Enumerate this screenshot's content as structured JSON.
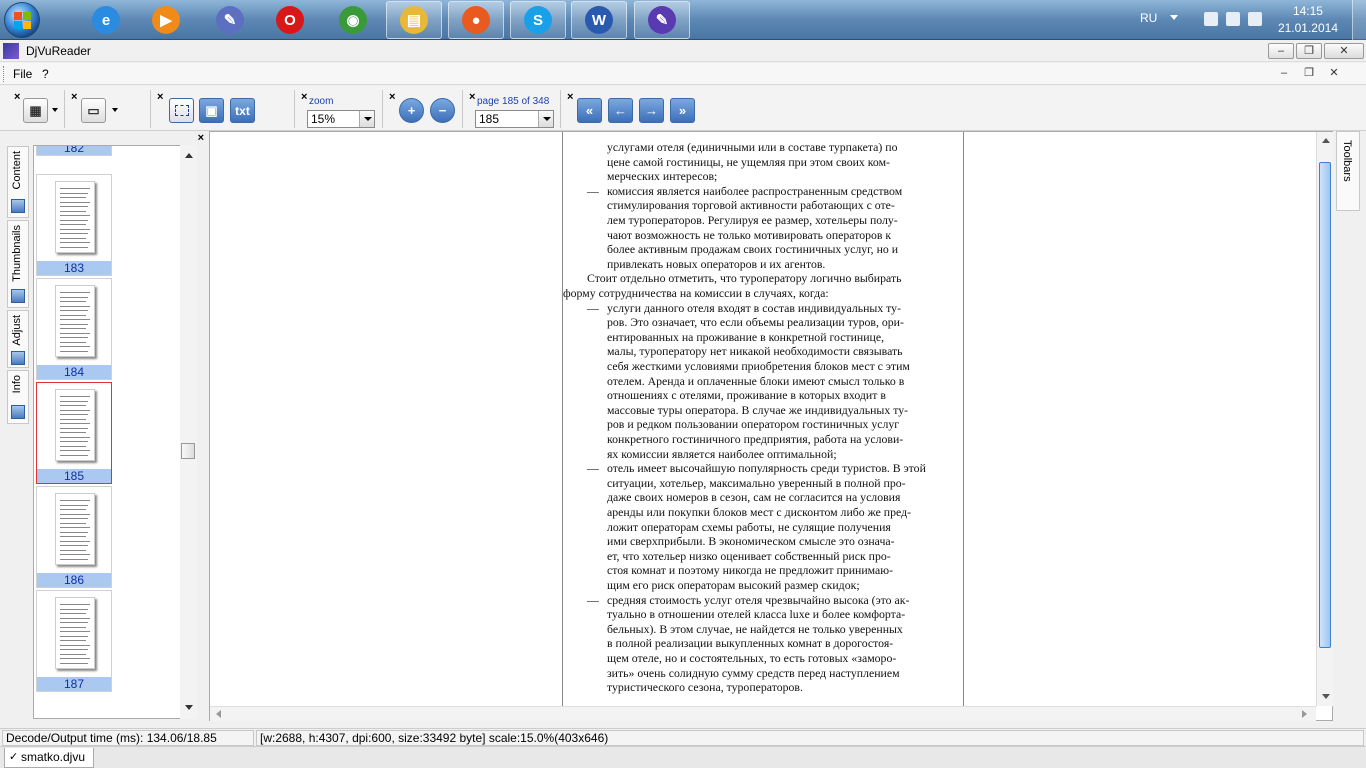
{
  "taskbar": {
    "apps": [
      {
        "name": "internet-explorer",
        "color": "#2a8be0",
        "glyph": "e"
      },
      {
        "name": "media-player",
        "color": "#f08a18",
        "glyph": "▶"
      },
      {
        "name": "tools",
        "color": "#5c6fc0",
        "glyph": "✎"
      },
      {
        "name": "opera",
        "color": "#d81818",
        "glyph": "O"
      },
      {
        "name": "chrome",
        "color": "#3a9a3a",
        "glyph": "◉"
      },
      {
        "name": "file-explorer",
        "color": "#e8b838",
        "glyph": "▤"
      },
      {
        "name": "app-colorful",
        "color": "#e85a20",
        "glyph": "●"
      },
      {
        "name": "skype",
        "color": "#1aa0e8",
        "glyph": "S"
      },
      {
        "name": "word",
        "color": "#2a5ab0",
        "glyph": "W"
      },
      {
        "name": "djvureader",
        "color": "#5a3ab0",
        "glyph": "✎"
      }
    ],
    "tray": {
      "lang": "RU",
      "time": "14:15",
      "date": "21.01.2014"
    }
  },
  "window": {
    "title": "DjVuReader"
  },
  "menu": {
    "file": "File",
    "help": "?"
  },
  "toolbar": {
    "zoom_label": "zoom",
    "zoom_value": "15%",
    "page_label": "page 185 of 348",
    "page_value": "185",
    "txt_label": "txt"
  },
  "sidetabs": {
    "content": "Content",
    "thumbnails": "Thumbnails",
    "adjust": "Adjust",
    "info": "Info"
  },
  "thumbnails": [
    "182",
    "183",
    "184",
    "185",
    "186",
    "187"
  ],
  "selected_thumbnail": "185",
  "document": {
    "lines_1": [
      "услугами отеля (единичными или в составе турпакета) по",
      "цене самой гостиницы, не ущемляя при этом своих ком-",
      "мерческих интересов;"
    ],
    "lines_2": [
      "комиссия является наиболее распространенным средством",
      "стимулирования торговой активности работающих с оте-",
      "лем туроператоров. Регулируя ее размер, хотельеры полу-",
      "чают возможность не только мотивировать операторов к",
      "более активным продажам своих гостиничных услуг, но и",
      "привлекать новых операторов и их агентов."
    ],
    "lines_3": [
      "Стоит отдельно отметить, что туроператору логично выбирать",
      "форму сотрудничества на комиссии в случаях, когда:"
    ],
    "lines_4": [
      "услуги данного отеля входят в состав индивидуальных ту-",
      "ров. Это означает, что если объемы реализации туров, ори-",
      "ентированных на проживание в конкретной гостинице,",
      "малы, туроператору нет никакой необходимости связывать",
      "себя жесткими условиями приобретения блоков мест с этим",
      "отелем. Аренда и оплаченные блоки имеют смысл только в",
      "отношениях с отелями, проживание в которых входит в",
      "массовые туры оператора. В случае же индивидуальных ту-",
      "ров и редком пользовании оператором гостиничных услуг",
      "конкретного гостиничного предприятия, работа на услови-",
      "ях комиссии является наиболее оптимальной;"
    ],
    "lines_5": [
      "отель имеет высочайшую популярность среди туристов. В этой",
      "ситуации, хотельер, максимально уверенный в полной про-",
      "даже своих номеров в сезон, сам не согласится на условия",
      "аренды или покупки блоков мест с дисконтом либо же пред-",
      "ложит операторам схемы работы, не сулящие получения",
      "ими сверхприбыли. В экономическом смысле это означа-",
      "ет, что хотельер низко оценивает собственный риск про-",
      "стоя комнат и поэтому никогда не предложит принимаю-",
      "щим его риск операторам высокий размер скидок;"
    ],
    "lines_6": [
      "средняя стоимость услуг отеля чрезвычайно высока (это ак-",
      "туально в отношении отелей класса luxe и более комфорта-",
      "бельных). В этом случае, не найдется не только уверенных",
      "в полной реализации выкупленных комнат в дорогостоя-",
      "щем отеле, но и состоятельных, то есть готовых «заморо-",
      "зить» очень солидную сумму средств перед наступлением",
      "туристического сезона, туроператоров."
    ],
    "dash": "—"
  },
  "right_tab": "Toolbars",
  "status": {
    "decode": "Decode/Output time (ms): 134.06/18.85",
    "info": "[w:2688, h:4307, dpi:600, size:33492 byte] scale:15.0%(403x646)"
  },
  "doc_tab": "smatko.djvu"
}
